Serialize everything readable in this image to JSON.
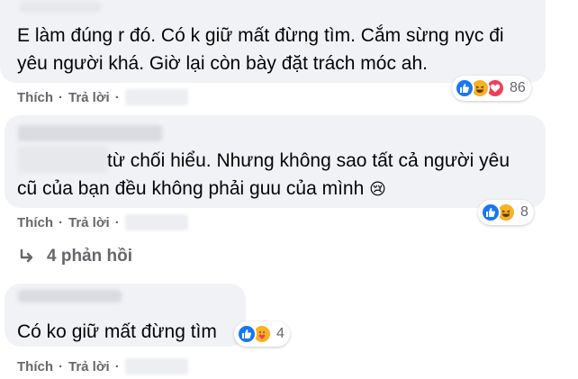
{
  "comments": [
    {
      "lines": [
        "E làm đúng r đó. Có k giữ mất đừng tìm. Cắm sừng nyc đi",
        "yêu người khá. Giờ lại còn bày đặt trách móc ah."
      ],
      "actions": {
        "like": "Thích",
        "reply": "Trả lời",
        "sep": "·"
      },
      "reactions": {
        "icons": [
          "like-icon",
          "haha-icon",
          "love-icon"
        ],
        "count": "86"
      }
    },
    {
      "lines": [
        "từ chối hiểu. Nhưng không sao tất cả người yêu",
        "cũ của bạn đều không phải guu của mình"
      ],
      "emoji": "😢",
      "actions": {
        "like": "Thích",
        "reply": "Trả lời",
        "sep": "·"
      },
      "reactions": {
        "icons": [
          "like-icon",
          "haha-icon"
        ],
        "count": "8"
      }
    },
    {
      "lines": [
        "Có ko giữ mất đừng tìm"
      ],
      "actions": {
        "like": "Thích",
        "reply": "Trả lời",
        "sep": "·"
      },
      "reactions": {
        "icons": [
          "like-icon",
          "care-icon"
        ],
        "count": "4"
      }
    }
  ],
  "replies_link": "4 phản hồi",
  "colors": {
    "bubble": "#f0f2f5",
    "meta": "#65676b",
    "like": "#1877f2",
    "haha": "#f7b125",
    "love": "#f33e58"
  }
}
